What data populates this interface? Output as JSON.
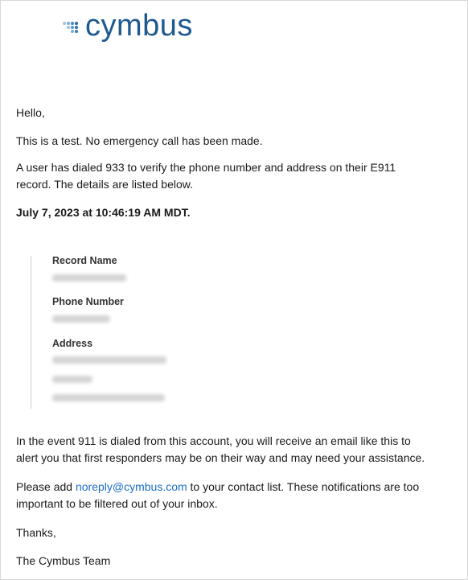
{
  "brand": {
    "name": "cymbus",
    "color": "#1e5a8e"
  },
  "greeting": "Hello,",
  "test_notice": "This is a test. No emergency call has been made.",
  "intro": {
    "line1": "A user has dialed 933 to verify the phone number and address on their E911",
    "line2": "record. The details are listed below."
  },
  "timestamp": "July 7, 2023 at 10:46:19 AM MDT.",
  "record": {
    "name_label": "Record Name",
    "phone_label": "Phone Number",
    "address_label": "Address"
  },
  "event_note": {
    "line1": "In the event 911 is dialed from this account, you will receive an email like this to",
    "line2": "alert you that first responders may be on their way and may need your assistance."
  },
  "contact": {
    "prefix": "Please add ",
    "email": "noreply@cymbus.com",
    "suffix": " to your contact list. These notifications are too",
    "line2": "important to be filtered out of your inbox."
  },
  "thanks": "Thanks,",
  "signature": "The Cymbus Team"
}
